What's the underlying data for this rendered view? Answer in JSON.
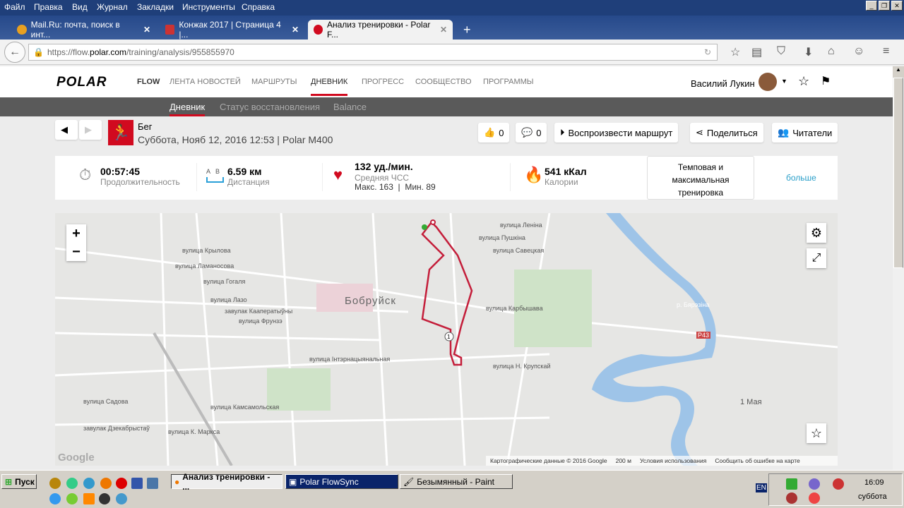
{
  "menu": [
    "Файл",
    "Правка",
    "Вид",
    "Журнал",
    "Закладки",
    "Инструменты",
    "Справка"
  ],
  "tabs": [
    {
      "label": "Mail.Ru: почта, поиск в инт..."
    },
    {
      "label": "Конжак 2017 | Страница 4 |..."
    },
    {
      "label": "Анализ тренировки - Polar F..."
    }
  ],
  "url": {
    "prefix": "https://flow.",
    "domain": "polar.com",
    "path": "/training/analysis/955855970"
  },
  "polar": {
    "logo": "POLAR",
    "flow": "FLOW",
    "nav": [
      "ЛЕНТА НОВОСТЕЙ",
      "МАРШРУТЫ",
      "ДНЕВНИК",
      "ПРОГРЕСС",
      "СООБЩЕСТВО",
      "ПРОГРАММЫ"
    ],
    "user": "Василий Лукин"
  },
  "subnav": [
    "Дневник",
    "Статус восстановления",
    "Balance"
  ],
  "training": {
    "sport": "Бег",
    "date": "Суббота, Нояб 12, 2016 12:53 | Polar M400"
  },
  "actions": {
    "likes": "0",
    "comments": "0",
    "replay": "Воспроизвести маршрут",
    "share": "Поделиться",
    "readers": "Читатели"
  },
  "stats": {
    "duration": "00:57:45",
    "duration_label": "Продолжительность",
    "ab": "A   B",
    "distance": "6.59 км",
    "distance_label": "Дистанция",
    "hr": "132 уд./мин.",
    "hr_label": "Средняя ЧСС",
    "hr_range": "Макс. 163  |  Мин. 89",
    "calories": "541 кКал",
    "calories_label": "Калории",
    "benefit": "Темповая и максимальная тренировка",
    "more": "больше"
  },
  "map": {
    "city": "Бобруйск",
    "labels": [
      "вулица Гогаля",
      "вулица Крылова",
      "вулица Ламаносова",
      "вулица Лазо",
      "завулак Кааператыўны",
      "вулица Фрунзэ",
      "вулица Інтэрнацыянальная",
      "вулица Камсамольская",
      "вулица Садова",
      "завулак Дзекабрыстаў",
      "вулица К. Маркса",
      "вулица Пушкіна",
      "вулица Савецкая",
      "вулица Карбышава",
      "вулица Леніна",
      "вулица Н. Крупскай",
      "р. Бярэзіна",
      "1 Мая",
      "P43"
    ],
    "attribution": "Картографические данные © 2016 Google",
    "scale": "200 м",
    "terms": "Условия использования",
    "report": "Сообщить об ошибке на карте",
    "google": "Google",
    "marker": "1",
    "zoom_in": "+",
    "zoom_out": "−"
  },
  "taskbar": {
    "start": "Пуск",
    "tasks": [
      "Анализ тренировки - ...",
      "Polar FlowSync",
      "Безымянный - Paint"
    ],
    "lang": "EN",
    "time": "16:09",
    "day": "суббота"
  }
}
